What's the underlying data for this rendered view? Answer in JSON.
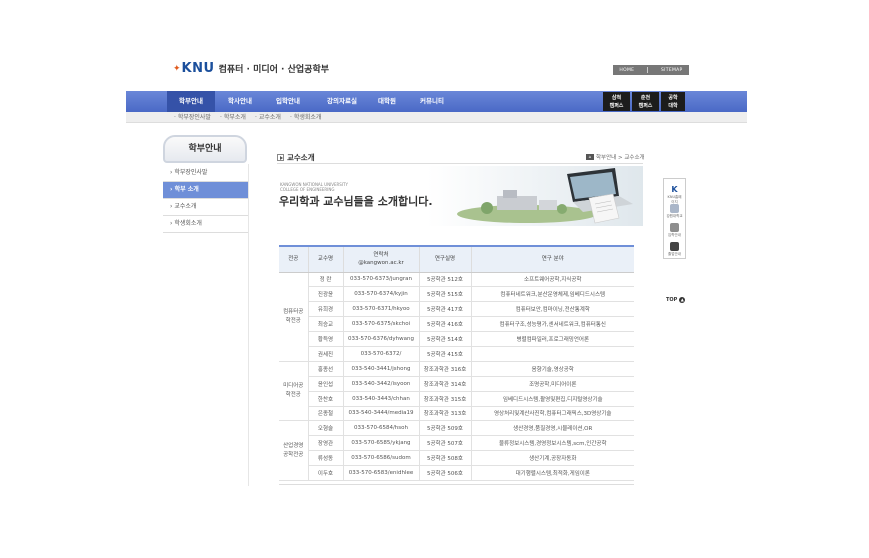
{
  "header": {
    "logo_text": "KNU",
    "dept_name": "컴퓨터 · 미디어 · 산업공학부",
    "top_links": [
      "HOME",
      "SITEMAP"
    ]
  },
  "nav": {
    "items": [
      "학부안내",
      "학사안내",
      "입학안내",
      "강의자료실",
      "대학원",
      "커뮤니티"
    ],
    "campus_buttons": [
      "삼척\n캠퍼스",
      "춘천\n캠퍼스",
      "공학\n대학"
    ]
  },
  "subnav": {
    "items": [
      "학부장인사말",
      "학부소개",
      "교수소개",
      "학생회소개"
    ]
  },
  "sidebar": {
    "title": "학부안내",
    "items": [
      "학부장인사말",
      "학부 소개",
      "교수소개",
      "학생회소개"
    ],
    "active_index": 1
  },
  "content": {
    "title": "교수소개",
    "breadcrumb": "학부안내 > 교수소개",
    "banner_eng": [
      "KANGWON NATIONAL UNIVERSITY",
      "COLLEGE OF ENGINEERING"
    ],
    "banner_headline": "우리학과 교수님들을 소개합니다."
  },
  "table": {
    "headers": [
      "전공",
      "교수명",
      "연락처\n@kangwon.ac.kr",
      "연구실명",
      "연구 분야"
    ],
    "groups": [
      {
        "major": "컴퓨터공\n학전공",
        "rows": [
          [
            "정 란",
            "033-570-6373/jungran",
            "5공학관 512호",
            "소프트웨어공학,지식공학"
          ],
          [
            "진광윤",
            "033-570-6374/kyjin",
            "5공학관 515호",
            "컴퓨터네트워크,분산운영체제,임베디드시스템"
          ],
          [
            "유희경",
            "033-570-6371/hkyoo",
            "5공학관 417호",
            "컴퓨터보안,컴마이닝,전산통계학"
          ],
          [
            "최승교",
            "033-570-6375/skchoi",
            "5공학관 416호",
            "컴퓨터구조,성능평가,센서네트워크,컴퓨터통신"
          ],
          [
            "황득영",
            "033-570-6376/dyhwang",
            "5공학관 514호",
            "병렬컴파일러,프로그래밍언어론"
          ],
          [
            "권세진",
            "033-570-6372/",
            "5공학관 415호",
            ""
          ]
        ]
      },
      {
        "major": "미디어공\n학전공",
        "rows": [
          [
            "홍종선",
            "033-540-3441/jshong",
            "창조과학관 316호",
            "음향기술,영상공학"
          ],
          [
            "윤인섭",
            "033-540-3442/isyoon",
            "창조과학관 314호",
            "조명공학,미디어이론"
          ],
          [
            "한찬호",
            "033-540-3443/chhan",
            "창조과학관 315호",
            "임베디드시스템,촬영및편집,디지털영상기술"
          ],
          [
            "은종철",
            "033-540-3444/media19",
            "창조과학관 313호",
            "영상처리및계산사진학,컴퓨터그래픽스,3D영상기술"
          ]
        ]
      },
      {
        "major": "산업경영\n공학전공",
        "rows": [
          [
            "오형술",
            "033-570-6584/hsoh",
            "5공학관 509호",
            "생산경영,품질경영,시뮬레이션,OR"
          ],
          [
            "장영관",
            "033-570-6585/ykjang",
            "5공학관 507호",
            "물류정보시스템,경영정보시스템,scm,인간공학"
          ],
          [
            "류성동",
            "033-570-6586/sudom",
            "5공학관 508호",
            "생산기계,공장자동화"
          ],
          [
            "이두호",
            "033-570-6583/enidhlee",
            "5공학관 506호",
            "대기행렬시스템,최적화,게임이론"
          ]
        ]
      }
    ]
  },
  "quick_menu": {
    "items": [
      "KNU홈페이지",
      "강원대학교",
      "입학안내",
      "졸업안내"
    ],
    "top_label": "TOP"
  },
  "colors": {
    "nav_bg": "#5a78cf",
    "nav_active": "#3552a8",
    "sidebar_active": "#6f8fd8",
    "logo": "#1b4f9c"
  }
}
